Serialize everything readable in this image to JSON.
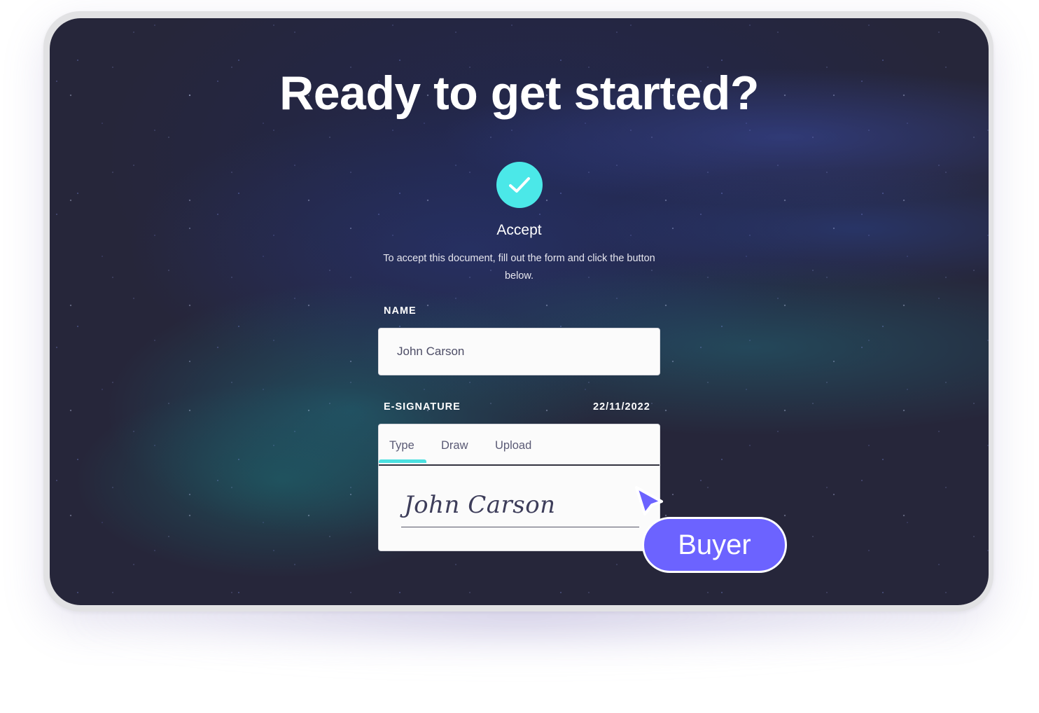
{
  "page": {
    "title": "Ready to get started?"
  },
  "accept": {
    "icon": "check-icon",
    "label": "Accept",
    "description": "To accept this document, fill out the form and click the button below."
  },
  "form": {
    "name": {
      "label": "NAME",
      "value": "John Carson"
    },
    "esignature": {
      "label": "E-SIGNATURE",
      "date": "22/11/2022",
      "tabs": [
        {
          "label": "Type",
          "active": true
        },
        {
          "label": "Draw",
          "active": false
        },
        {
          "label": "Upload",
          "active": false
        }
      ],
      "signature_text": "John Carson"
    }
  },
  "cursor_badge": {
    "icon": "pointer-cursor-icon",
    "label": "Buyer"
  },
  "colors": {
    "accent_teal": "#4be8e8",
    "badge_purple": "#6c63ff",
    "background_dark": "#26263a"
  }
}
